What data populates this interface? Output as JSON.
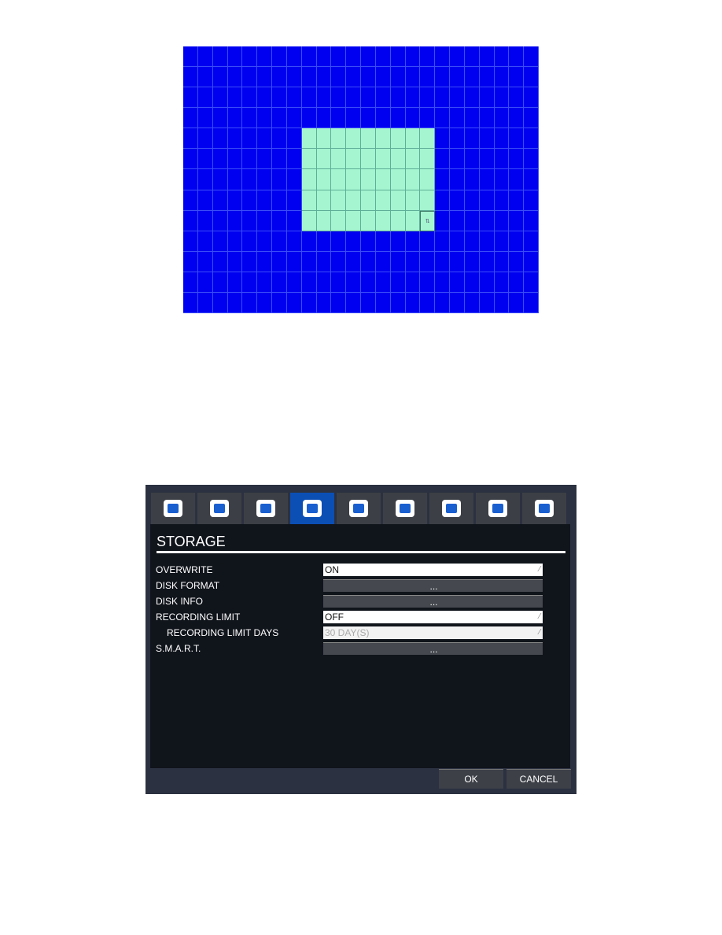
{
  "grid": {
    "columns": 24,
    "rows": 13,
    "selection": {
      "col_start": 8,
      "col_end": 16,
      "row_start": 4,
      "row_end": 8
    },
    "marker_label": "⇅",
    "colors": {
      "background": "#0000f0",
      "selected": "#a4f5d0"
    }
  },
  "dialog": {
    "tabs": [
      {
        "icon": "display-hand-icon"
      },
      {
        "icon": "record-disc-icon"
      },
      {
        "icon": "gear-icon"
      },
      {
        "icon": "pie-chart-icon",
        "active": true
      },
      {
        "icon": "computer-icon"
      },
      {
        "icon": "password-icon"
      },
      {
        "icon": "globe-icon"
      },
      {
        "icon": "device-io-icon"
      },
      {
        "icon": "search-folder-icon"
      }
    ],
    "title": "STORAGE",
    "rows": [
      {
        "label": "OVERWRITE",
        "type": "select",
        "value": "ON"
      },
      {
        "label": "DISK FORMAT",
        "type": "button",
        "value": "..."
      },
      {
        "label": "DISK INFO",
        "type": "button",
        "value": "..."
      },
      {
        "label": "RECORDING LIMIT",
        "type": "select",
        "value": "OFF"
      },
      {
        "label": "RECORDING LIMIT DAYS",
        "type": "select",
        "value": "30 DAY(S)",
        "disabled": true
      },
      {
        "label": "S.M.A.R.T.",
        "type": "button",
        "value": "..."
      }
    ],
    "ok": "OK",
    "cancel": "CANCEL"
  }
}
